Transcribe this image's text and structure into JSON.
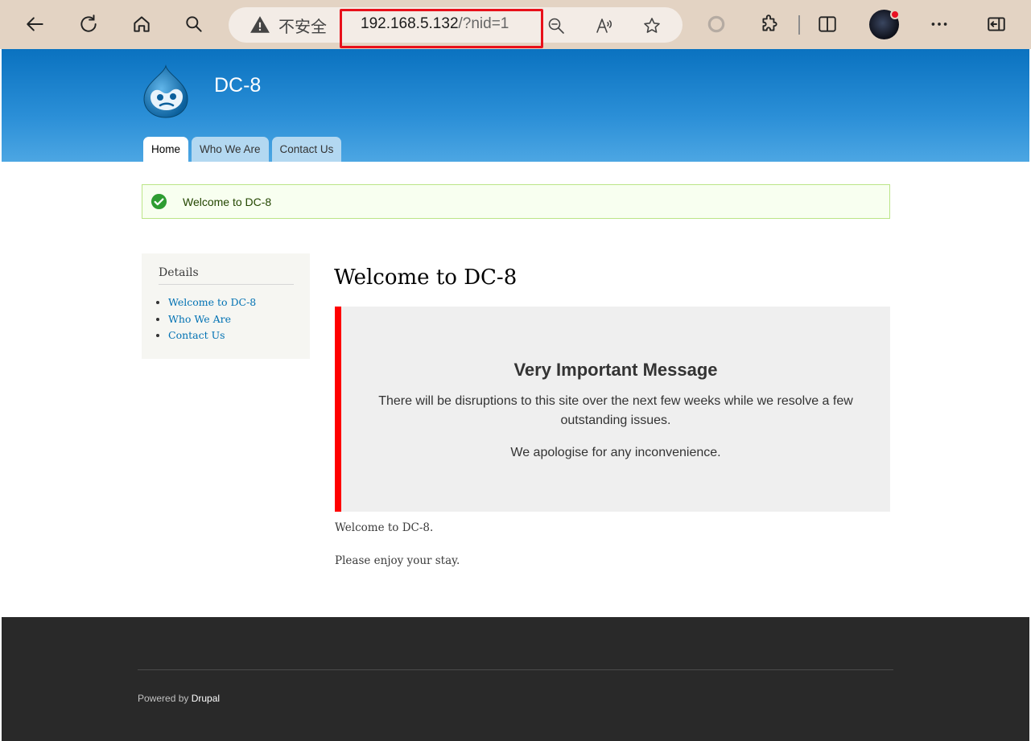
{
  "browser": {
    "security_label": "不安全",
    "url_host": "192.168.5.132",
    "url_path": "/?nid=1"
  },
  "site": {
    "name": "DC-8",
    "tabs": [
      {
        "label": "Home",
        "active": true
      },
      {
        "label": "Who We Are",
        "active": false
      },
      {
        "label": "Contact Us",
        "active": false
      }
    ]
  },
  "status": {
    "message": "Welcome to DC-8"
  },
  "sidebar": {
    "title": "Details",
    "links": [
      "Welcome to DC-8",
      "Who We Are",
      "Contact Us"
    ]
  },
  "main": {
    "title": "Welcome to DC-8",
    "alert": {
      "heading": "Very Important Message",
      "line1": "There will be disruptions to this site over the next few weeks while we resolve a few outstanding issues.",
      "line2": "We apologise for any inconvenience."
    },
    "paragraph1": "Welcome to DC-8.",
    "paragraph2": "Please enjoy your stay."
  },
  "footer": {
    "powered_prefix": "Powered by ",
    "powered_link": "Drupal"
  },
  "colors": {
    "header_blue": "#0a72c0",
    "alert_border": "#ff0000",
    "link": "#0071b3",
    "footer_bg": "#292929"
  }
}
